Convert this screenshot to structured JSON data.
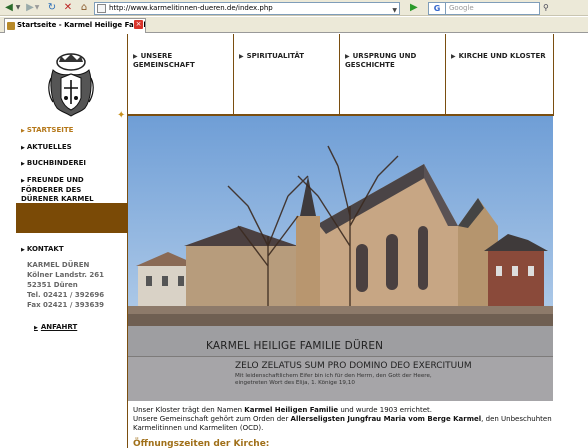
{
  "browser": {
    "url": "http://www.karmelitinnen-dueren.de/index.php",
    "search_engine": "G",
    "search_placeholder": "Google",
    "tab_title": "Startseite - Karmel Heilige Famili..."
  },
  "topnav": [
    {
      "label": "UNSERE GEMEINSCHAFT"
    },
    {
      "label": "SPIRITUALITÄT"
    },
    {
      "label": "URSPRUNG UND GESCHICHTE"
    },
    {
      "label": "KIRCHE UND KLOSTER"
    }
  ],
  "sidenav": {
    "items": [
      {
        "label": "STARTSEITE",
        "active": true
      },
      {
        "label": "AKTUELLES"
      },
      {
        "label": "BUCHBINDEREI"
      },
      {
        "label": "FREUNDE UND FÖRDERER DES DÜRENER KARMEL"
      }
    ],
    "kontakt": "KONTAKT",
    "anfahrt": "ANFAHRT"
  },
  "address": {
    "name": "KARMEL DÜREN",
    "street": "Kölner Landstr. 261",
    "city": "52351 Düren",
    "tel": "Tel. 02421 / 392696",
    "fax": "Fax 02421 / 393639"
  },
  "hero": {
    "title": "KARMEL HEILIGE FAMILIE DÜREN",
    "motto": "ZELO ZELATUS SUM PRO DOMINO DEO EXERCITUUM",
    "motto_sub": "Mit leidenschaftlichem Eifer bin ich für den Herrn,  den Gott der Heere, eingetreten  Wort des Elija, 1. Könige 19,10"
  },
  "intro": {
    "p1_pre": "Unser Kloster trägt den Namen ",
    "p1_bold": "Karmel Heiligen Familie",
    "p1_post": " und wurde 1903 errichtet.",
    "p2_pre": "Unsere Gemeinschaft gehört zum Orden der ",
    "p2_bold": "Allerseligsten Jungfrau Maria vom Berge Karmel",
    "p2_post": ", den Unbeschuhten Karmelitinnen und Karmeliten (OCD)."
  },
  "hours_heading": "Öffnungszeiten der Kirche:",
  "colors": {
    "brown": "#7a4e10",
    "accent": "#b5781a"
  }
}
